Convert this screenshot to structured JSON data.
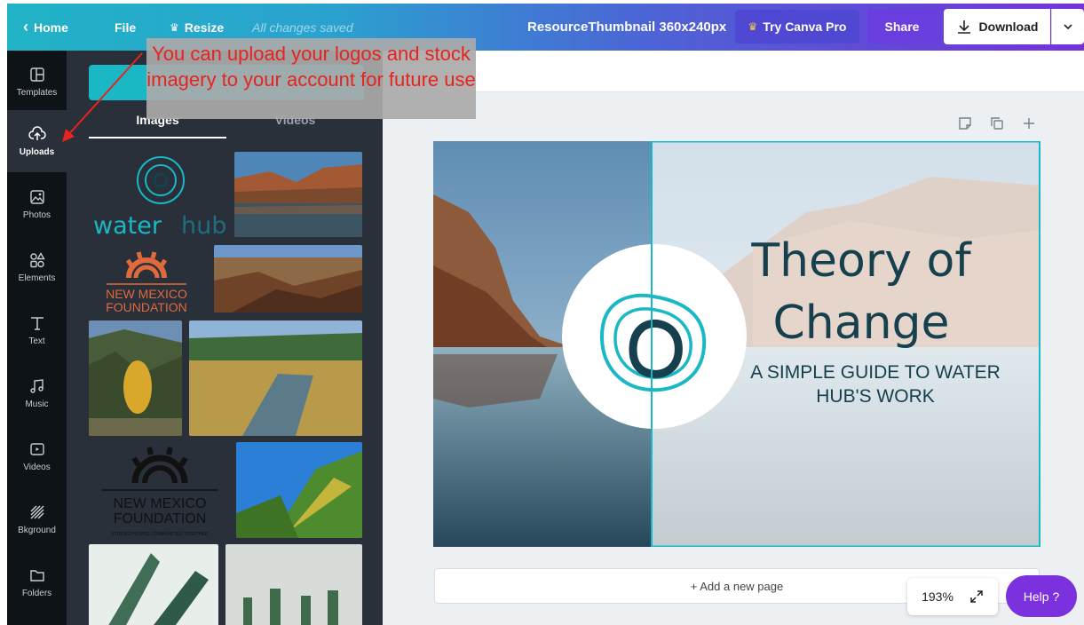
{
  "topbar": {
    "home": "Home",
    "file": "File",
    "resize": "Resize",
    "saved_status": "All changes saved",
    "doc_title": "ResourceThumbnail 360x240px",
    "try_pro": "Try Canva Pro",
    "share": "Share",
    "download": "Download"
  },
  "sidebar": {
    "items": [
      {
        "label": "Templates",
        "icon": "templates-icon"
      },
      {
        "label": "Uploads",
        "icon": "upload-cloud-icon"
      },
      {
        "label": "Photos",
        "icon": "photo-icon"
      },
      {
        "label": "Elements",
        "icon": "shapes-icon"
      },
      {
        "label": "Text",
        "icon": "text-icon"
      },
      {
        "label": "Music",
        "icon": "music-note-icon"
      },
      {
        "label": "Videos",
        "icon": "video-play-icon"
      },
      {
        "label": "Bkground",
        "icon": "background-stripes-icon"
      },
      {
        "label": "Folders",
        "icon": "folder-icon"
      }
    ],
    "active": "Uploads"
  },
  "panel": {
    "tabs": [
      "Images",
      "Videos"
    ],
    "active_tab": "Images",
    "logo_waterhub": {
      "water": "water",
      "hub": "hub"
    },
    "logo_nmf_small": {
      "line1": "NEW MEXICO",
      "line2": "FOUNDATION"
    },
    "logo_nmf_large": {
      "line1": "NEW MEXICO",
      "line2": "FOUNDATION",
      "tagline": "STRENGTHENING COMMUNITIES TOGETHER"
    }
  },
  "annotation": {
    "text": "You can upload your logos and stock imagery to your account for future use"
  },
  "design": {
    "title_line1": "Theory of",
    "title_line2": "Change",
    "subtitle_line1": "A SIMPLE GUIDE TO WATER",
    "subtitle_line2": "HUB'S WORK"
  },
  "workspace": {
    "add_page": "+ Add a new page",
    "zoom": "193%",
    "help": "Help ?"
  },
  "colors": {
    "teal": "#1ab7c5",
    "panel_bg": "#293039",
    "sidebar_bg": "#0e1318",
    "purple": "#7b32de",
    "title_color": "#16404e"
  }
}
